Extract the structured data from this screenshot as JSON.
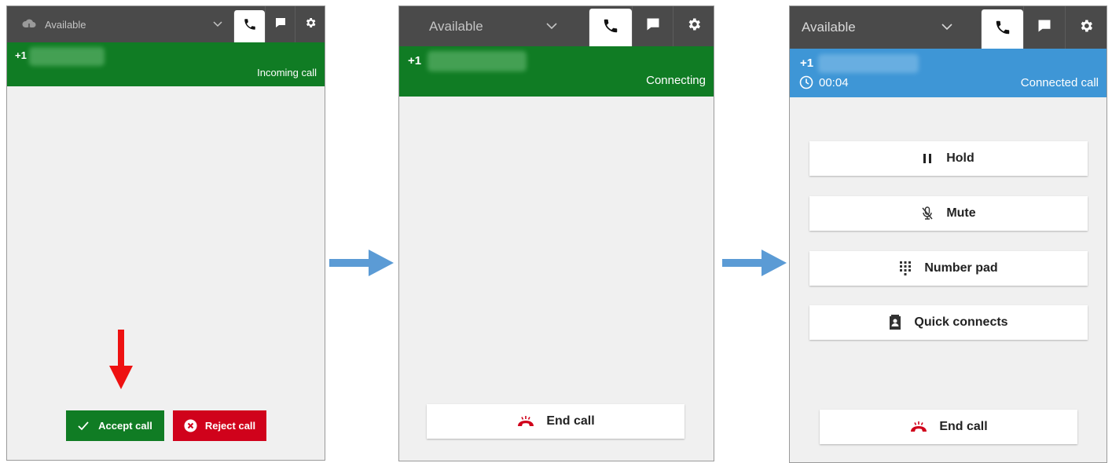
{
  "colors": {
    "topbar": "#4a4a4a",
    "green": "#107c24",
    "blue": "#3e96d6",
    "red": "#d0021b",
    "arrow_blue": "#5b9bd5",
    "end_call_red": "#d0021b"
  },
  "icons": {
    "status": "cloud-icon",
    "chevron": "chevron-down-icon",
    "phone": "phone-icon",
    "chat": "chat-icon",
    "settings": "gear-icon",
    "check": "check-icon",
    "reject": "x-circle-icon",
    "end_call": "hang-up-icon",
    "hold": "pause-icon",
    "mute": "mic-off-icon",
    "number_pad": "dialpad-icon",
    "quick_connects": "contact-book-icon",
    "timer": "clock-icon",
    "flow_arrow": "arrow-right-icon",
    "pointer_arrow": "arrow-down-icon"
  },
  "panel1": {
    "status": "Available",
    "phone_prefix": "+1",
    "call_state": "Incoming call",
    "accept_label": "Accept call",
    "reject_label": "Reject call"
  },
  "panel2": {
    "status": "Available",
    "phone_prefix": "+1",
    "call_state": "Connecting",
    "end_call_label": "End call"
  },
  "panel3": {
    "status": "Available",
    "phone_prefix": "+1",
    "timer": "00:04",
    "call_state": "Connected call",
    "actions": [
      "Hold",
      "Mute",
      "Number pad",
      "Quick connects"
    ],
    "end_call_label": "End call"
  }
}
